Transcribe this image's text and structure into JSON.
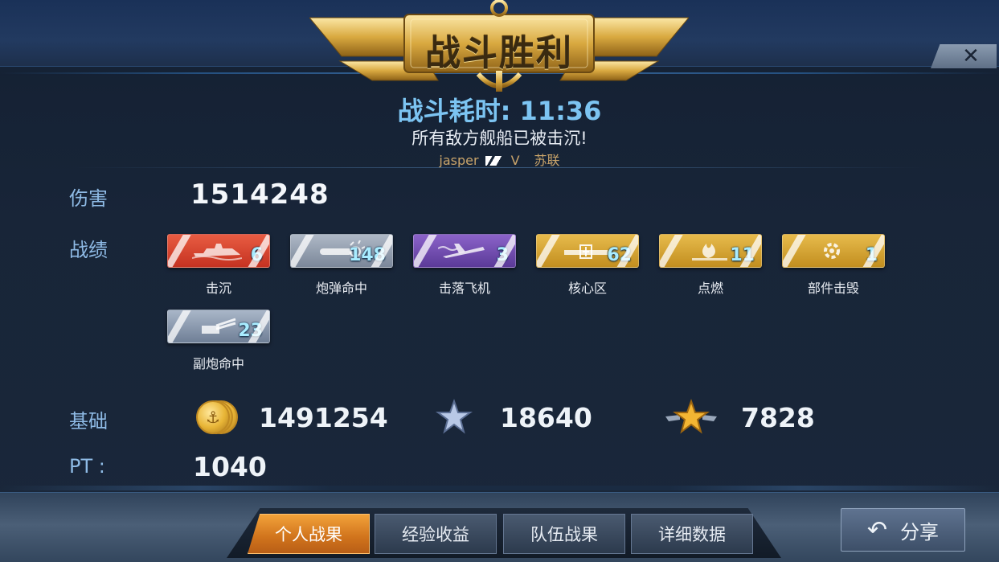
{
  "header": {
    "title": "战斗胜利",
    "close_glyph": "✕"
  },
  "summary": {
    "duration": "战斗耗时: 11:36",
    "message": "所有敌方舰船已被击沉!",
    "player_name": "jasper",
    "tier": "V",
    "nation": "苏联"
  },
  "damage": {
    "label": "伤害",
    "value": "1514248"
  },
  "record": {
    "label": "战绩",
    "items": [
      {
        "icon": "ship-sunk-icon",
        "count": "6",
        "label": "击沉",
        "color": "red"
      },
      {
        "icon": "shell-hit-icon",
        "count": "148",
        "label": "炮弹命中",
        "color": "silver"
      },
      {
        "icon": "plane-down-icon",
        "count": "3",
        "label": "击落飞机",
        "color": "purple"
      },
      {
        "icon": "citadel-icon",
        "count": "62",
        "label": "核心区",
        "color": "gold"
      },
      {
        "icon": "fire-icon",
        "count": "11",
        "label": "点燃",
        "color": "gold"
      },
      {
        "icon": "module-destroyed-icon",
        "count": "1",
        "label": "部件击毁",
        "color": "gold"
      },
      {
        "icon": "secondary-gun-icon",
        "count": "23",
        "label": "副炮命中",
        "color": "steel"
      }
    ]
  },
  "base": {
    "label": "基础",
    "credits": "1491254",
    "ship_xp": "18640",
    "commander_xp": "7828"
  },
  "pt": {
    "label": "PT :",
    "value": "1040"
  },
  "tabs": [
    {
      "label": "个人战果",
      "active": true
    },
    {
      "label": "经验收益",
      "active": false
    },
    {
      "label": "队伍战果",
      "active": false
    },
    {
      "label": "详细数据",
      "active": false
    }
  ],
  "share": {
    "label": "分享"
  },
  "colors": {
    "accent_blue": "#7cc4f2",
    "label_blue": "#8fbbe6",
    "gold": "#e7bb4c",
    "active_tab": "#d0731c"
  }
}
